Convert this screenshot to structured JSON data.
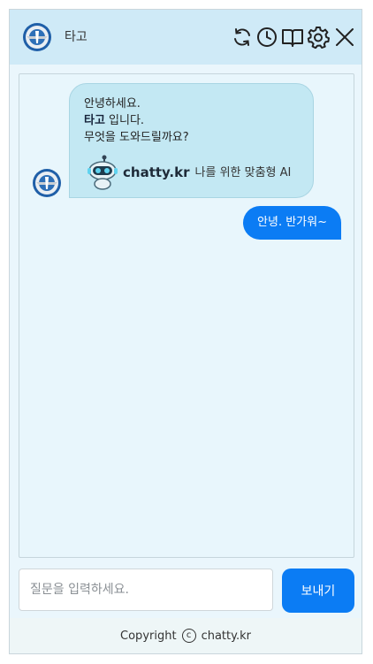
{
  "header": {
    "title": "타고",
    "icons": [
      "refresh-icon",
      "history-clock-icon",
      "book-icon",
      "gear-icon",
      "close-icon"
    ]
  },
  "chat": {
    "bot_message": {
      "line1": "안녕하세요.",
      "bot_name": "타고",
      "line2_suffix": " 입니다.",
      "line3": "무엇을 도와드릴까요?",
      "brand": "chatty.kr",
      "tagline": "나를 위한 맞춤형 AI"
    },
    "user_message": "안녕. 반가워~"
  },
  "input": {
    "placeholder": "질문을 입력하세요.",
    "value": ""
  },
  "send_label": "보내기",
  "footer": {
    "prefix": "Copyright",
    "symbol": "c",
    "site": "chatty.kr"
  },
  "colors": {
    "header_bg": "#cfeaf7",
    "chat_bg": "#e8f6fc",
    "bot_bubble": "#c3e8f3",
    "accent": "#0b7cf4"
  }
}
